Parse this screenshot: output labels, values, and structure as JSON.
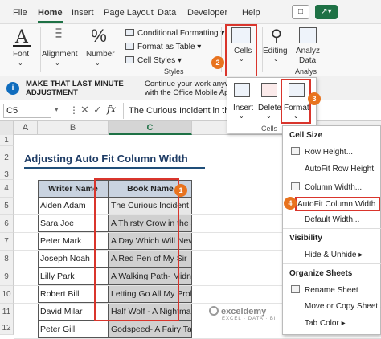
{
  "tabs": [
    "File",
    "Home",
    "Insert",
    "Page Layout",
    "Data",
    "Developer",
    "Help"
  ],
  "ribbon": {
    "font_label": "Font",
    "alignment_label": "Alignment",
    "number_label": "Number",
    "number_symbol": "%",
    "conditional_formatting": "Conditional Formatting",
    "format_as_table": "Format as Table",
    "cell_styles": "Cell Styles",
    "styles_group": "Styles",
    "cells_label": "Cells",
    "editing_label": "Editing",
    "analyze_label_1": "Analyz",
    "analyze_label_2": "Data",
    "analysis_group": "Analys"
  },
  "notice": {
    "left_line1": "MAKE THAT LAST MINUTE",
    "left_line2": "ADJUSTMENT",
    "right_line1": "Continue your work anywh",
    "right_line2": "with the Office Mobile App"
  },
  "formula_bar": {
    "name_box": "C5",
    "fx": "fx",
    "content": "The Curious Incident in the"
  },
  "cells_popup": {
    "insert": "Insert",
    "delete": "Delete",
    "format": "Format",
    "group": "Cells"
  },
  "columns": [
    "A",
    "B",
    "C"
  ],
  "rows": [
    "1",
    "2",
    "3",
    "4",
    "5",
    "6",
    "7",
    "8",
    "9",
    "10",
    "11",
    "12"
  ],
  "sheet": {
    "title": "Adjusting Auto Fit Column Width",
    "header_writer": "Writer Name",
    "header_book": "Book Name",
    "data": [
      {
        "writer": "Aiden Adam",
        "book": "The Curious Incident in the Night"
      },
      {
        "writer": "Sara Joe",
        "book": "A Thirsty Crow in the Jungle"
      },
      {
        "writer": "Peter Mark",
        "book": "A Day Which Will Never be Forgotten"
      },
      {
        "writer": "Joseph Noah",
        "book": "A Red Pen of My Sir"
      },
      {
        "writer": "Lilly Park",
        "book": "A Walking Path- Midnight Tales"
      },
      {
        "writer": "Robert Bill",
        "book": "Letting Go All My Problems"
      },
      {
        "writer": "David Milar",
        "book": "Half Wolf - A Nightmare"
      },
      {
        "writer": "Peter Gill",
        "book": "Godspeed- A Fairy Tale"
      }
    ]
  },
  "format_menu": {
    "cell_size": "Cell Size",
    "row_height": "Row Height...",
    "autofit_row": "AutoFit Row Height",
    "column_width": "Column Width...",
    "autofit_column": "AutoFit Column Width",
    "default_width": "Default Width...",
    "visibility": "Visibility",
    "hide_unhide": "Hide & Unhide",
    "organize": "Organize Sheets",
    "rename": "Rename Sheet",
    "move_copy": "Move or Copy Sheet...",
    "tab_color": "Tab Color"
  },
  "badges": [
    "1",
    "2",
    "3",
    "4"
  ],
  "watermark": "exceldemy",
  "watermark_sub": "EXCEL · DATA · BI",
  "colors": {
    "accent": "#1e7145",
    "highlight": "#d9352c",
    "badge": "#e8731f"
  }
}
